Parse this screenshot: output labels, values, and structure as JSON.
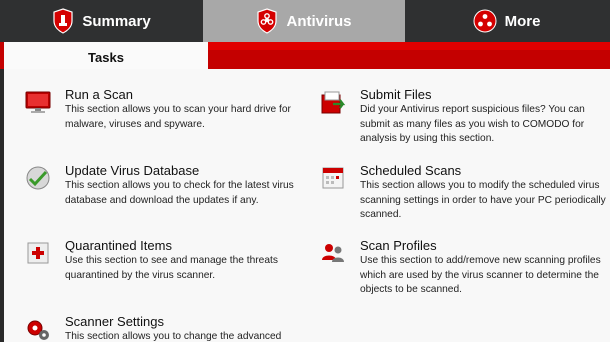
{
  "top_tabs": [
    {
      "label": "Summary",
      "icon": "shield-icon",
      "active": false
    },
    {
      "label": "Antivirus",
      "icon": "biohazard-shield-icon",
      "active": true
    },
    {
      "label": "More",
      "icon": "more-dots-icon",
      "active": false
    }
  ],
  "sub_tab": {
    "label": "Tasks"
  },
  "colors": {
    "accent_red": "#c40000",
    "active_tab": "#a8a8a8",
    "dark_bar": "#2f3031"
  },
  "tasks": [
    {
      "title": "Run a Scan",
      "description": "This section allows you to scan your hard drive for malware, viruses and spyware.",
      "icon": "monitor-scan-icon"
    },
    {
      "title": "Submit Files",
      "description": "Did your Antivirus report suspicious files? You can submit as many files as you wish to COMODO for analysis by using this section.",
      "icon": "submit-files-icon"
    },
    {
      "title": "Update Virus Database",
      "description": "This section allows you to check for the latest virus database and download the updates if any.",
      "icon": "update-globe-icon"
    },
    {
      "title": "Scheduled Scans",
      "description": "This section allows you to modify the scheduled virus scanning settings in order to have your PC periodically scanned.",
      "icon": "calendar-icon"
    },
    {
      "title": "Quarantined Items",
      "description": "Use this section to see and manage the threats quarantined by the virus scanner.",
      "icon": "quarantine-icon"
    },
    {
      "title": "Scan Profiles",
      "description": "Use this section to add/remove new scanning profiles which are used by the virus scanner to determine the objects to be scanned.",
      "icon": "scan-profiles-icon"
    },
    {
      "title": "Scanner Settings",
      "description": "This section allows you to change the advanced",
      "icon": "gears-icon"
    }
  ]
}
